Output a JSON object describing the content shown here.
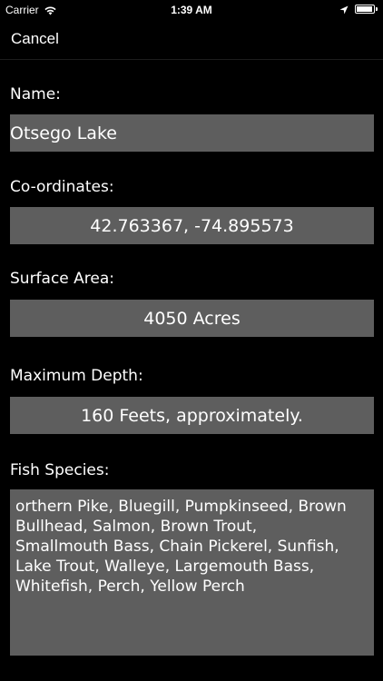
{
  "status_bar": {
    "carrier": "Carrier",
    "time": "1:39 AM",
    "battery_level": 0.95
  },
  "nav": {
    "cancel_label": "Cancel"
  },
  "form": {
    "name_label": "Name:",
    "name_value": "Otsego Lake",
    "coordinates_label": "Co-ordinates:",
    "coordinates_value": "42.763367, -74.895573",
    "surface_area_label": "Surface Area:",
    "surface_area_value": "4050 Acres",
    "max_depth_label": "Maximum Depth:",
    "max_depth_value": "160 Feets, approximately.",
    "fish_species_label": "Fish Species:",
    "fish_species_value": "orthern Pike, Bluegill, Pumpkinseed, Brown\nBullhead, Salmon, Brown Trout,\nSmallmouth Bass, Chain Pickerel, Sunfish,\nLake Trout, Walleye, Largemouth Bass,\nWhitefish, Perch, Yellow Perch"
  },
  "colors": {
    "background": "#000000",
    "field_background": "#5e5e5e",
    "text": "#ffffff"
  },
  "icons": {
    "wifi": "wifi-icon",
    "location": "location-arrow-icon",
    "battery": "battery-icon"
  }
}
